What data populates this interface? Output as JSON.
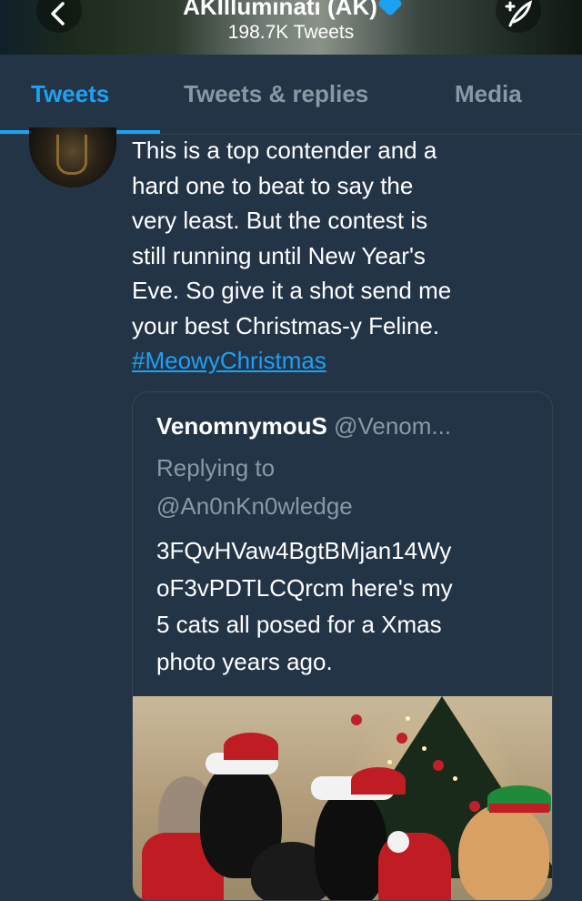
{
  "header": {
    "title": "AKIlluminati (AK)",
    "tweet_count": "198.7K Tweets",
    "back_icon": "chevron-left-icon",
    "compose_icon": "compose-feather-icon"
  },
  "tabs": [
    {
      "label": "Tweets",
      "active": true
    },
    {
      "label": "Tweets & replies",
      "active": false
    },
    {
      "label": "Media",
      "active": false
    }
  ],
  "tweet": {
    "lines": [
      "This is a top contender and a",
      "hard one to beat to say the",
      "very least. But the contest is",
      "still running until New Year's",
      "Eve. So give it a shot send me",
      "your best Christmas-y Feline."
    ],
    "hashtag": "#MeowyChristmas"
  },
  "quoted_tweet": {
    "name": "VenomnymouS",
    "handle": "@Venom...",
    "replying_to_label": "Replying to",
    "replying_to_handle": "@An0nKn0wledge",
    "lines": [
      "3FQvHVaw4BgtBMjan14Wy",
      "oF3vPDTLCQrcm here's my",
      "5 cats all posed for a Xmas",
      "photo years ago."
    ]
  },
  "colors": {
    "accent": "#1da1f2",
    "background": "#243447",
    "muted": "#8899a6"
  }
}
